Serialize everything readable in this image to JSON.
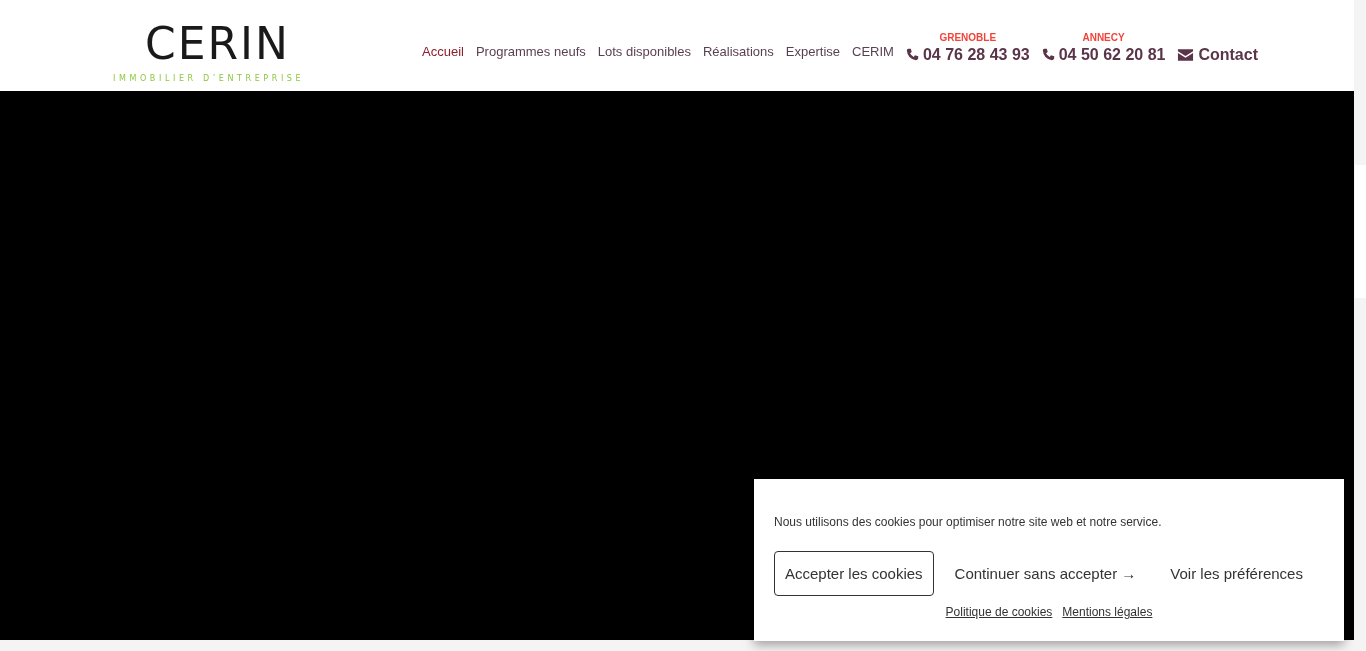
{
  "logo": {
    "name": "CERIN",
    "tagline": "IMMOBILIER D’ENTREPRISE"
  },
  "nav": [
    {
      "label": "Accueil",
      "selected": true
    },
    {
      "label": "Programmes neufs",
      "selected": false
    },
    {
      "label": "Lots disponibles",
      "selected": false
    },
    {
      "label": "Réalisations",
      "selected": false
    },
    {
      "label": "Expertise",
      "selected": false
    },
    {
      "label": "CERIM",
      "selected": false
    }
  ],
  "phones": [
    {
      "city": "GRENOBLE",
      "number": "04 76 28 43 93"
    },
    {
      "city": "ANNECY",
      "number": "04 50 62 20 81"
    }
  ],
  "contact": "Contact",
  "hero": {
    "kind": "video"
  },
  "cookie_banner": {
    "message": "Nous utilisons des cookies pour optimiser notre site web et notre service.",
    "buttons": [
      {
        "label": "Accepter les cookies",
        "kind": "outlined"
      },
      {
        "label": "Continuer sans accepter →",
        "kind": "plain"
      },
      {
        "label": "Voir les préférences",
        "kind": "plain"
      }
    ],
    "links": [
      "Politique de cookies",
      "Mentions légales"
    ]
  }
}
